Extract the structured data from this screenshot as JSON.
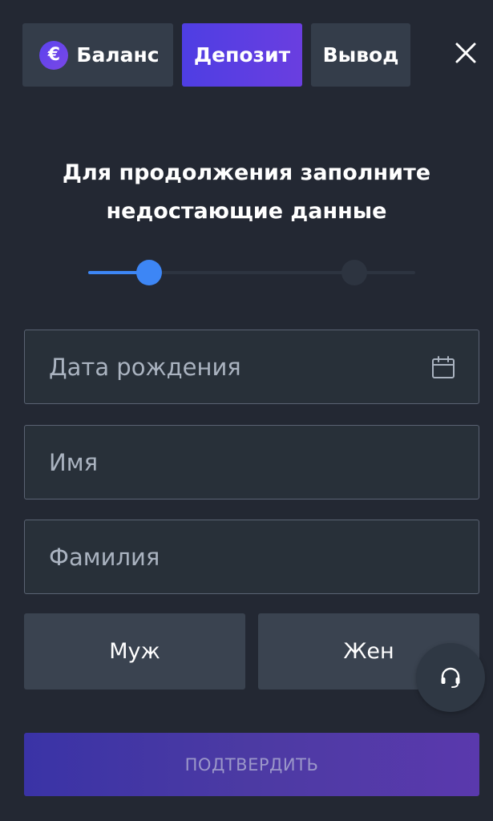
{
  "tabs": {
    "balance_label": "Баланс",
    "balance_icon": "€",
    "deposit_label": "Депозит",
    "withdraw_label": "Вывод",
    "active": "deposit"
  },
  "close_icon": "close-icon",
  "title": {
    "line1": "Для продолжения заполните",
    "line2": "недостающие данные"
  },
  "progress": {
    "current_step": 1,
    "total_steps": 2,
    "fill_fraction": 0.18
  },
  "form": {
    "dob_placeholder": "Дата рождения",
    "dob_value": "",
    "first_name_placeholder": "Имя",
    "first_name_value": "",
    "last_name_placeholder": "Фамилия",
    "last_name_value": ""
  },
  "gender": {
    "male_label": "Муж",
    "female_label": "Жен"
  },
  "confirm_label": "ПОДТВЕРДИТЬ",
  "colors": {
    "background": "#232833",
    "accent_blue": "#3d86f5",
    "accent_purple": "#5b43ee",
    "button_gray": "#3a4350"
  }
}
